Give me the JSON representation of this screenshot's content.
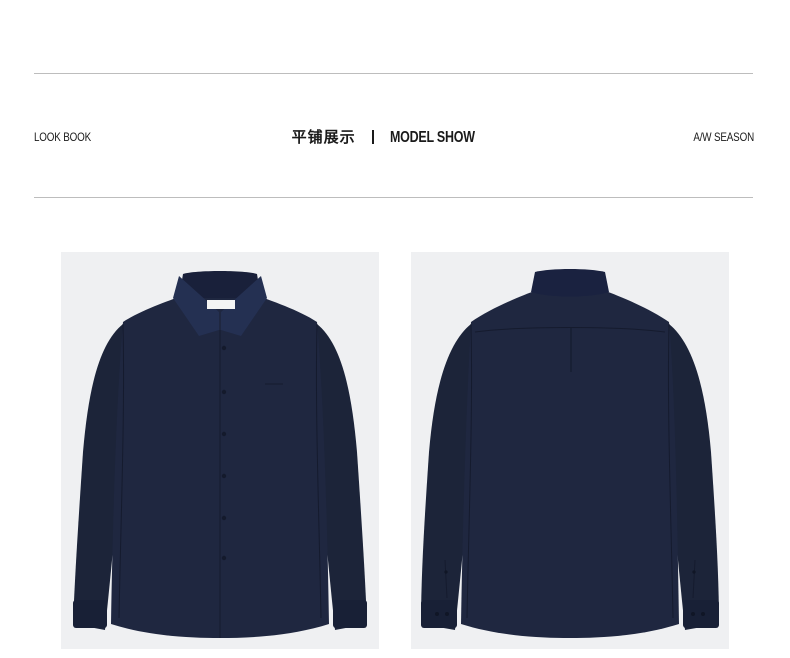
{
  "header": {
    "left_label": "LOOK BOOK",
    "center_cn": "平铺展示",
    "center_en": "MODEL SHOW",
    "right_label": "A/W SEASON"
  },
  "colors": {
    "shirt": "#1f2740",
    "shirt_shadow": "#151b2e",
    "panel_bg": "#eff0f2",
    "rule": "#bdbdbd"
  },
  "images": [
    {
      "name": "shirt-front-image",
      "view": "front"
    },
    {
      "name": "shirt-back-image",
      "view": "back"
    }
  ]
}
